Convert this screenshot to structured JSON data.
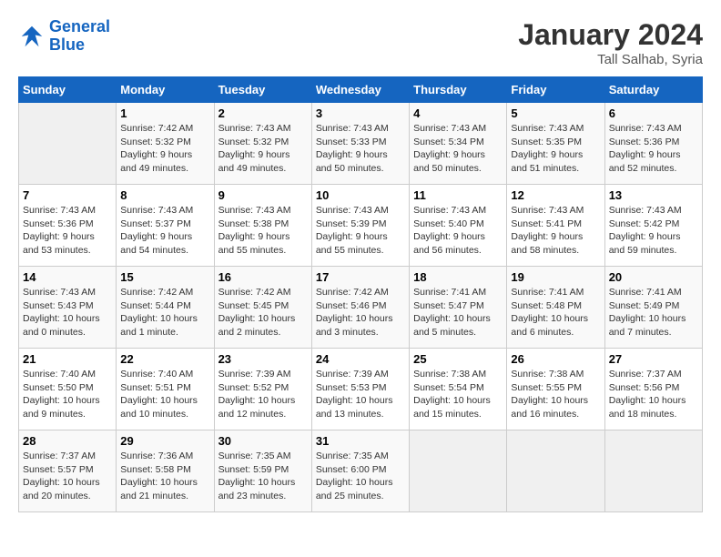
{
  "logo": {
    "line1": "General",
    "line2": "Blue"
  },
  "title": "January 2024",
  "location": "Tall Salhab, Syria",
  "days_of_week": [
    "Sunday",
    "Monday",
    "Tuesday",
    "Wednesday",
    "Thursday",
    "Friday",
    "Saturday"
  ],
  "weeks": [
    [
      {
        "num": "",
        "empty": true
      },
      {
        "num": "1",
        "sunrise": "7:42 AM",
        "sunset": "5:32 PM",
        "daylight": "9 hours and 49 minutes."
      },
      {
        "num": "2",
        "sunrise": "7:43 AM",
        "sunset": "5:32 PM",
        "daylight": "9 hours and 49 minutes."
      },
      {
        "num": "3",
        "sunrise": "7:43 AM",
        "sunset": "5:33 PM",
        "daylight": "9 hours and 50 minutes."
      },
      {
        "num": "4",
        "sunrise": "7:43 AM",
        "sunset": "5:34 PM",
        "daylight": "9 hours and 50 minutes."
      },
      {
        "num": "5",
        "sunrise": "7:43 AM",
        "sunset": "5:35 PM",
        "daylight": "9 hours and 51 minutes."
      },
      {
        "num": "6",
        "sunrise": "7:43 AM",
        "sunset": "5:36 PM",
        "daylight": "9 hours and 52 minutes."
      }
    ],
    [
      {
        "num": "7",
        "sunrise": "7:43 AM",
        "sunset": "5:36 PM",
        "daylight": "9 hours and 53 minutes."
      },
      {
        "num": "8",
        "sunrise": "7:43 AM",
        "sunset": "5:37 PM",
        "daylight": "9 hours and 54 minutes."
      },
      {
        "num": "9",
        "sunrise": "7:43 AM",
        "sunset": "5:38 PM",
        "daylight": "9 hours and 55 minutes."
      },
      {
        "num": "10",
        "sunrise": "7:43 AM",
        "sunset": "5:39 PM",
        "daylight": "9 hours and 55 minutes."
      },
      {
        "num": "11",
        "sunrise": "7:43 AM",
        "sunset": "5:40 PM",
        "daylight": "9 hours and 56 minutes."
      },
      {
        "num": "12",
        "sunrise": "7:43 AM",
        "sunset": "5:41 PM",
        "daylight": "9 hours and 58 minutes."
      },
      {
        "num": "13",
        "sunrise": "7:43 AM",
        "sunset": "5:42 PM",
        "daylight": "9 hours and 59 minutes."
      }
    ],
    [
      {
        "num": "14",
        "sunrise": "7:43 AM",
        "sunset": "5:43 PM",
        "daylight": "10 hours and 0 minutes."
      },
      {
        "num": "15",
        "sunrise": "7:42 AM",
        "sunset": "5:44 PM",
        "daylight": "10 hours and 1 minute."
      },
      {
        "num": "16",
        "sunrise": "7:42 AM",
        "sunset": "5:45 PM",
        "daylight": "10 hours and 2 minutes."
      },
      {
        "num": "17",
        "sunrise": "7:42 AM",
        "sunset": "5:46 PM",
        "daylight": "10 hours and 3 minutes."
      },
      {
        "num": "18",
        "sunrise": "7:41 AM",
        "sunset": "5:47 PM",
        "daylight": "10 hours and 5 minutes."
      },
      {
        "num": "19",
        "sunrise": "7:41 AM",
        "sunset": "5:48 PM",
        "daylight": "10 hours and 6 minutes."
      },
      {
        "num": "20",
        "sunrise": "7:41 AM",
        "sunset": "5:49 PM",
        "daylight": "10 hours and 7 minutes."
      }
    ],
    [
      {
        "num": "21",
        "sunrise": "7:40 AM",
        "sunset": "5:50 PM",
        "daylight": "10 hours and 9 minutes."
      },
      {
        "num": "22",
        "sunrise": "7:40 AM",
        "sunset": "5:51 PM",
        "daylight": "10 hours and 10 minutes."
      },
      {
        "num": "23",
        "sunrise": "7:39 AM",
        "sunset": "5:52 PM",
        "daylight": "10 hours and 12 minutes."
      },
      {
        "num": "24",
        "sunrise": "7:39 AM",
        "sunset": "5:53 PM",
        "daylight": "10 hours and 13 minutes."
      },
      {
        "num": "25",
        "sunrise": "7:38 AM",
        "sunset": "5:54 PM",
        "daylight": "10 hours and 15 minutes."
      },
      {
        "num": "26",
        "sunrise": "7:38 AM",
        "sunset": "5:55 PM",
        "daylight": "10 hours and 16 minutes."
      },
      {
        "num": "27",
        "sunrise": "7:37 AM",
        "sunset": "5:56 PM",
        "daylight": "10 hours and 18 minutes."
      }
    ],
    [
      {
        "num": "28",
        "sunrise": "7:37 AM",
        "sunset": "5:57 PM",
        "daylight": "10 hours and 20 minutes."
      },
      {
        "num": "29",
        "sunrise": "7:36 AM",
        "sunset": "5:58 PM",
        "daylight": "10 hours and 21 minutes."
      },
      {
        "num": "30",
        "sunrise": "7:35 AM",
        "sunset": "5:59 PM",
        "daylight": "10 hours and 23 minutes."
      },
      {
        "num": "31",
        "sunrise": "7:35 AM",
        "sunset": "6:00 PM",
        "daylight": "10 hours and 25 minutes."
      },
      {
        "num": "",
        "empty": true
      },
      {
        "num": "",
        "empty": true
      },
      {
        "num": "",
        "empty": true
      }
    ]
  ]
}
